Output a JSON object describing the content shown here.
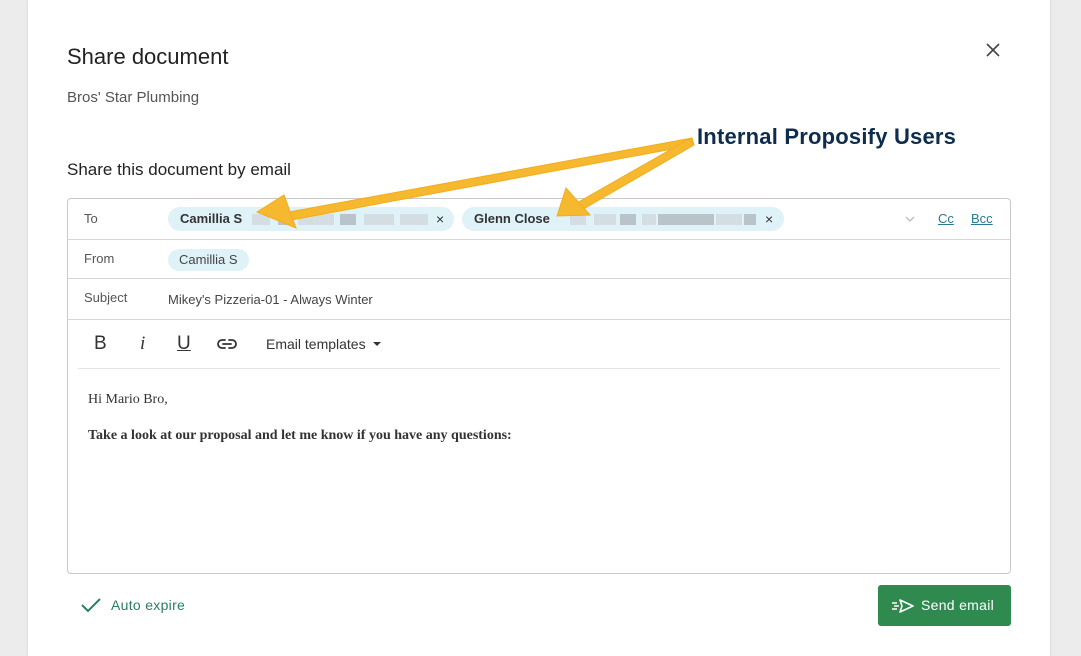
{
  "dialog": {
    "title": "Share document",
    "subtitle": "Bros' Star Plumbing",
    "section_title": "Share this document by email"
  },
  "form": {
    "to_label": "To",
    "to_recipients": [
      {
        "name": "Camillia S",
        "remove_icon": "×"
      },
      {
        "name": "Glenn Close",
        "remove_icon": "×"
      }
    ],
    "cc_label": "Cc",
    "bcc_label": "Bcc",
    "from_label": "From",
    "from_value": "Camillia S",
    "subject_label": "Subject",
    "subject_value": "Mikey's Pizzeria-01 - Always Winter"
  },
  "toolbar": {
    "bold": "B",
    "italic": "i",
    "underline": "U",
    "link_icon": "link-icon",
    "templates_label": "Email templates"
  },
  "message": {
    "greeting": "Hi Mario Bro,",
    "line": "Take a look at our proposal and let me know if you have any questions:"
  },
  "footer": {
    "auto_expire_label": "Auto expire",
    "send_label": "Send email"
  },
  "annotation": {
    "text": "Internal Proposify Users",
    "color": "#f5b82e"
  },
  "colors": {
    "accent": "#2f8a4f",
    "chip": "#dff2f8",
    "link": "#2a7a8f"
  }
}
